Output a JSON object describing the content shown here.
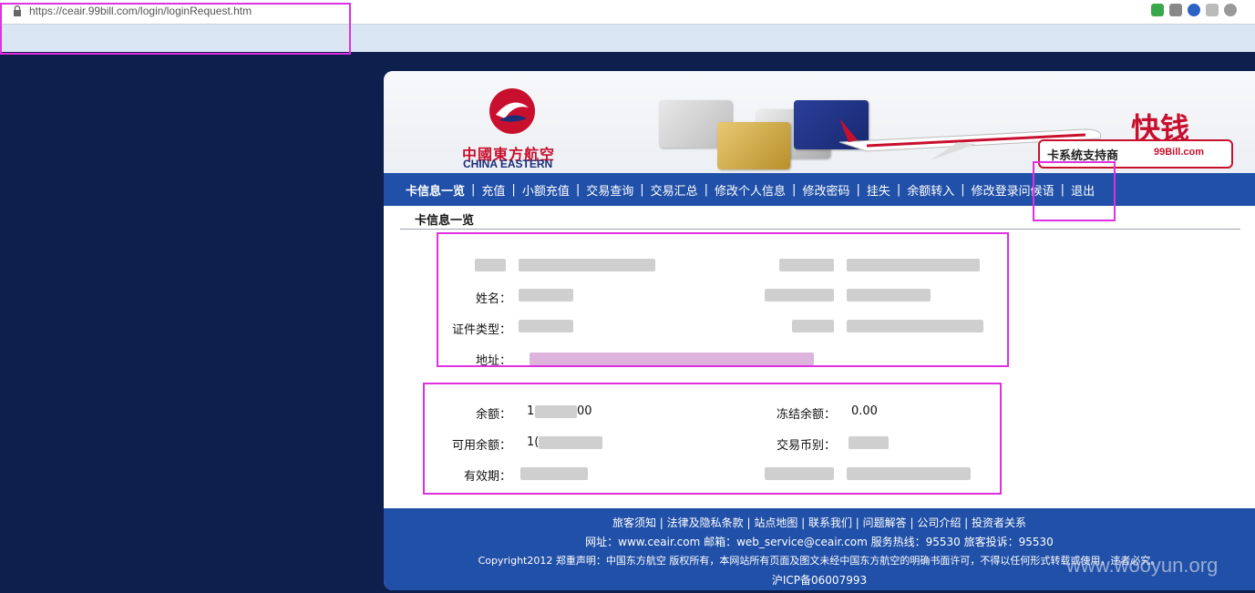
{
  "browser": {
    "url": "https://ceair.99bill.com/login/loginRequest.htm"
  },
  "brand": {
    "name_cn": "中國東方航空",
    "name_en": "CHINA EASTERN",
    "partner_logo": "快钱",
    "support_label": "卡系统支持商",
    "support_brand": "99Bill.com"
  },
  "nav": {
    "items": [
      "卡信息一览",
      "充值",
      "小额充值",
      "交易查询",
      "交易汇总",
      "修改个人信息",
      "修改密码",
      "挂失",
      "余额转入",
      "修改登录问候语",
      "退出"
    ]
  },
  "page": {
    "title": "卡信息一览"
  },
  "card_info": {
    "name_label": "姓名：",
    "id_type_label": "证件类型：",
    "address_label": "地址："
  },
  "balance": {
    "balance_label": "余额：",
    "balance_prefix": "1",
    "balance_suffix": "00",
    "frozen_label": "冻结余额：",
    "frozen_value": "0.00",
    "available_label": "可用余额：",
    "available_prefix": "1(",
    "currency_label": "交易币别：",
    "expiry_label": "有效期："
  },
  "footer": {
    "links": "旅客须知 | 法律及隐私条款 | 站点地图 | 联系我们 | 问题解答 | 公司介绍 | 投资者关系",
    "contact": "网址：www.ceair.com 邮箱：web_service@ceair.com 服务热线：95530 旅客投诉：95530",
    "copyright": "Copyright2012 郑重声明：中国东方航空 版权所有，本网站所有页面及图文未经中国东方航空的明确书面许可，不得以任何形式转载或使用，违者必究。",
    "icp": "沪ICP备06007993"
  },
  "watermark": "www.wooyun.org",
  "colors": {
    "nav_bg": "#2150a8",
    "page_bg": "#0d1f4c",
    "brand_red": "#c8102e",
    "annotation": "#e030e0"
  }
}
